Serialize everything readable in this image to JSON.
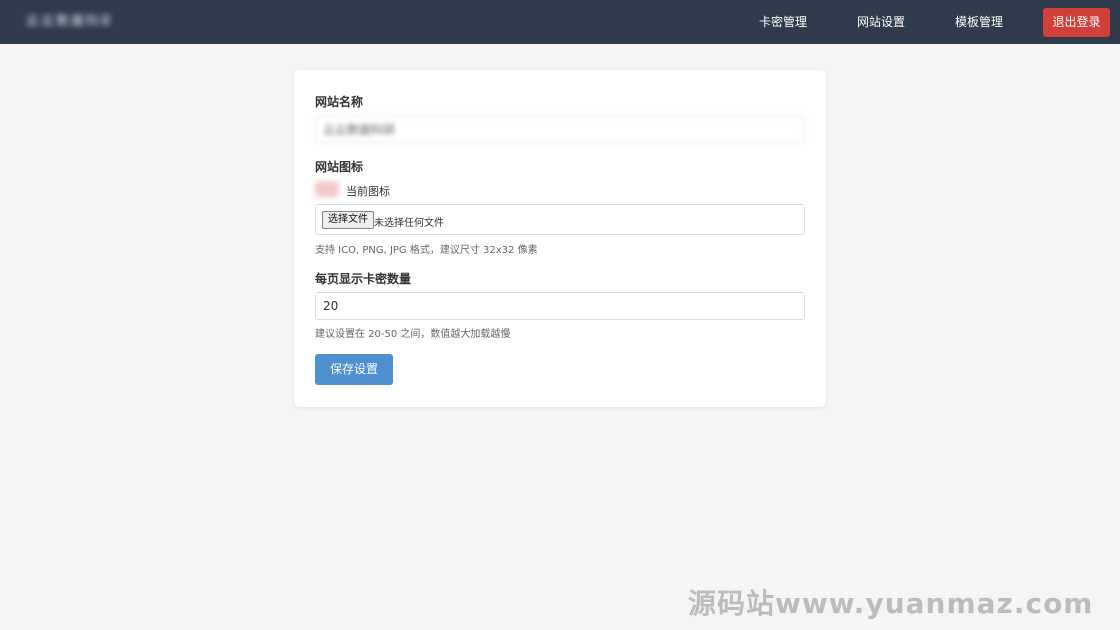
{
  "navbar": {
    "brand": "云云数据科研",
    "links": [
      "卡密管理",
      "网站设置",
      "模板管理"
    ],
    "logout_label": "退出登录",
    "background": "#2f3a4c",
    "logout_color": "#d0403a"
  },
  "form": {
    "site_name": {
      "label": "网站名称",
      "value": "云云数据科研"
    },
    "site_icon": {
      "label": "网站图标",
      "current_icon_label": "当前图标",
      "choose_file_label": "选择文件",
      "file_status": "未选择任何文件",
      "hint": "支持 ICO, PNG, JPG 格式，建议尺寸 32x32 像素"
    },
    "per_page": {
      "label": "每页显示卡密数量",
      "value": "20",
      "hint": "建议设置在 20-50 之间，数值越大加载越慢"
    },
    "save_label": "保存设置",
    "save_color": "#4e90d0"
  },
  "watermark": "源码站www.yuanmaz.com"
}
